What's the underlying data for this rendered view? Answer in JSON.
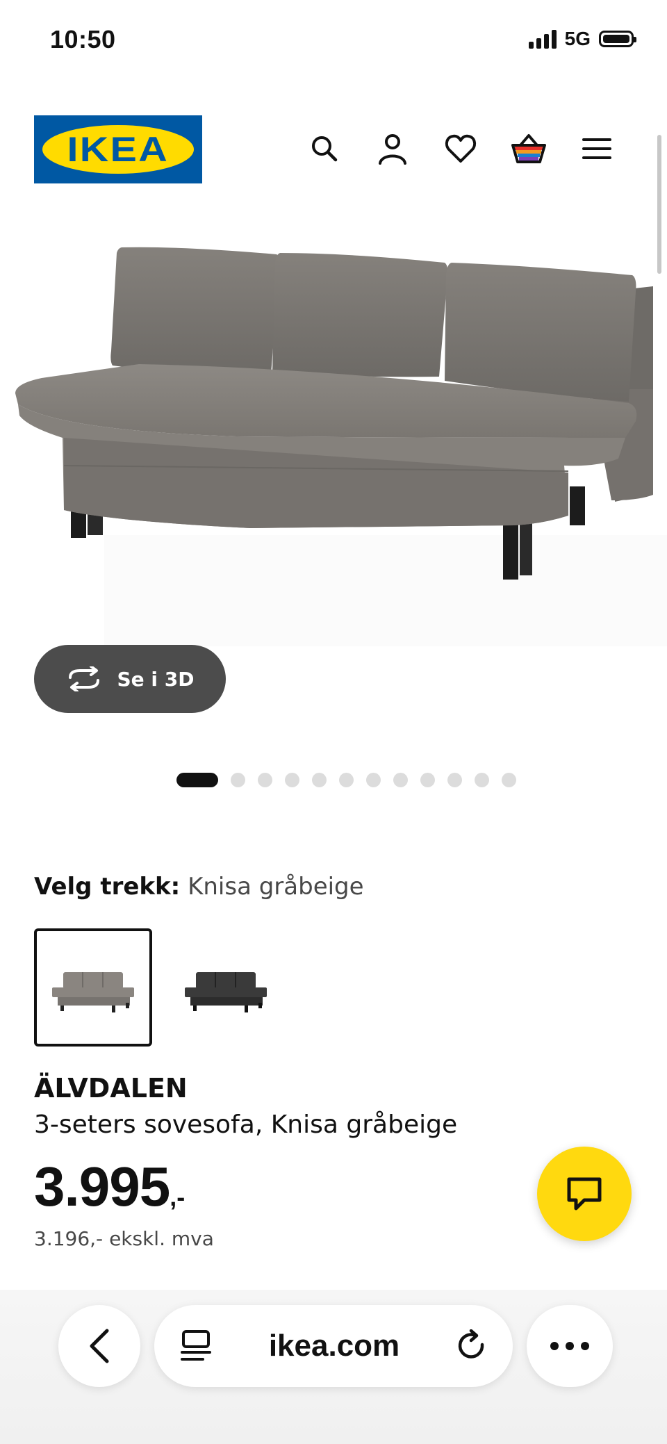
{
  "status_bar": {
    "time": "10:50",
    "network": "5G",
    "battery_level": 1.0
  },
  "header": {
    "logo_text": "IKEA",
    "icons": [
      "search-icon",
      "account-icon",
      "heart-icon",
      "basket-icon",
      "menu-icon"
    ]
  },
  "product": {
    "view_3d_label": "Se i 3D",
    "carousel": {
      "total": 12,
      "active_index": 0
    },
    "cover_label": "Velg trekk:",
    "cover_value": "Knisa gråbeige",
    "variants": [
      {
        "color": "#8a8580",
        "selected": true
      },
      {
        "color": "#3a3a3a",
        "selected": false
      }
    ],
    "name": "ÄLVDALEN",
    "description": "3-seters sovesofa, Knisa gråbeige",
    "price": "3.995",
    "price_suffix": ",-",
    "price_ex_vat": "3.196,- ekskl. mva"
  },
  "browser": {
    "url": "ikea.com"
  },
  "colors": {
    "brand_blue": "#0058a3",
    "brand_yellow": "#ffdb00",
    "chat_yellow": "#ffd90f",
    "sofa_grey": "#8a8580"
  }
}
